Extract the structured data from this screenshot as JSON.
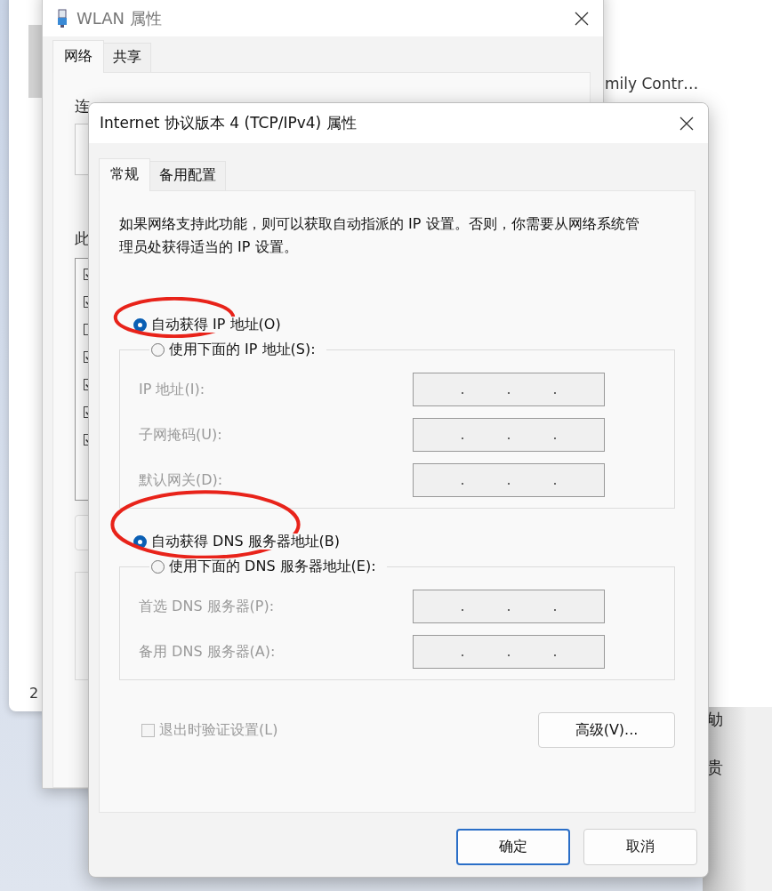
{
  "background_window": {
    "cut_text": "mily Contr…",
    "page_number": "2",
    "lower_texts": [
      "劬",
      "贵"
    ]
  },
  "wlan_window": {
    "title": "WLAN 属性",
    "tabs": [
      {
        "label": "网络",
        "selected": true
      },
      {
        "label": "共享",
        "selected": false
      }
    ],
    "cut_labels": [
      "连",
      "此"
    ],
    "components": [
      {
        "checked": true
      },
      {
        "checked": true
      },
      {
        "checked": false
      },
      {
        "checked": true
      },
      {
        "checked": true
      },
      {
        "checked": true
      },
      {
        "checked": true
      }
    ]
  },
  "ipv4_dialog": {
    "title": "Internet 协议版本 4 (TCP/IPv4) 属性",
    "tabs": [
      {
        "label": "常规",
        "selected": true
      },
      {
        "label": "备用配置",
        "selected": false
      }
    ],
    "description": "如果网络支持此功能，则可以获取自动指派的 IP 设置。否则，你需要从网络系统管理员处获得适当的 IP 设置。",
    "ip_options": [
      {
        "label": "自动获得 IP 地址(O)",
        "selected": true,
        "circled": true
      },
      {
        "label": "使用下面的 IP 地址(S):",
        "selected": false,
        "circled": false
      }
    ],
    "ip_fields": [
      {
        "label": "IP 地址(I):",
        "disabled": true
      },
      {
        "label": "子网掩码(U):",
        "disabled": true
      },
      {
        "label": "默认网关(D):",
        "disabled": true
      }
    ],
    "dns_options": [
      {
        "label": "自动获得 DNS 服务器地址(B)",
        "selected": true,
        "circled": true
      },
      {
        "label": "使用下面的 DNS 服务器地址(E):",
        "selected": false,
        "circled": false
      }
    ],
    "dns_fields": [
      {
        "label": "首选 DNS 服务器(P):",
        "disabled": true
      },
      {
        "label": "备用 DNS 服务器(A):",
        "disabled": true
      }
    ],
    "validate_checkbox": {
      "label": "退出时验证设置(L)",
      "checked": false,
      "disabled": true
    },
    "advanced_button": "高级(V)...",
    "buttons": [
      {
        "label": "确定",
        "default": true
      },
      {
        "label": "取消",
        "default": false
      }
    ]
  }
}
